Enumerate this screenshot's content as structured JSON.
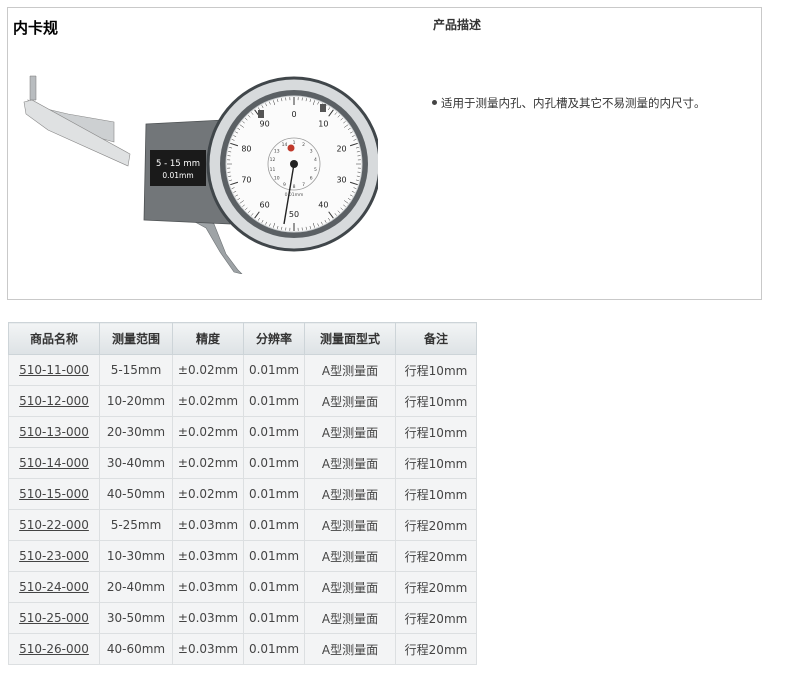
{
  "product": {
    "title": "内卡规",
    "image_label_range": "5 - 15 mm",
    "image_label_resolution": "0.01mm",
    "dial_numbers_outer": [
      "0",
      "10",
      "20",
      "30",
      "40",
      "50",
      "60",
      "70",
      "80",
      "90"
    ],
    "dial_numbers_inner": [
      "1",
      "2",
      "3",
      "4",
      "5",
      "6",
      "7",
      "8",
      "9",
      "10",
      "11",
      "12",
      "13",
      "14"
    ],
    "dial_small_text": "0.01mm"
  },
  "description": {
    "heading": "产品描述",
    "items": [
      "适用于测量内孔、内孔槽及其它不易测量的内尺寸。"
    ]
  },
  "table": {
    "headers": [
      "商品名称",
      "测量范围",
      "精度",
      "分辨率",
      "测量面型式",
      "备注"
    ],
    "rows": [
      [
        "510-11-000",
        "5-15mm",
        "±0.02mm",
        "0.01mm",
        "A型测量面",
        "行程10mm"
      ],
      [
        "510-12-000",
        "10-20mm",
        "±0.02mm",
        "0.01mm",
        "A型测量面",
        "行程10mm"
      ],
      [
        "510-13-000",
        "20-30mm",
        "±0.02mm",
        "0.01mm",
        "A型测量面",
        "行程10mm"
      ],
      [
        "510-14-000",
        "30-40mm",
        "±0.02mm",
        "0.01mm",
        "A型测量面",
        "行程10mm"
      ],
      [
        "510-15-000",
        "40-50mm",
        "±0.02mm",
        "0.01mm",
        "A型测量面",
        "行程10mm"
      ],
      [
        "510-22-000",
        "5-25mm",
        "±0.03mm",
        "0.01mm",
        "A型测量面",
        "行程20mm"
      ],
      [
        "510-23-000",
        "10-30mm",
        "±0.03mm",
        "0.01mm",
        "A型测量面",
        "行程20mm"
      ],
      [
        "510-24-000",
        "20-40mm",
        "±0.03mm",
        "0.01mm",
        "A型测量面",
        "行程20mm"
      ],
      [
        "510-25-000",
        "30-50mm",
        "±0.03mm",
        "0.01mm",
        "A型测量面",
        "行程20mm"
      ],
      [
        "510-26-000",
        "40-60mm",
        "±0.03mm",
        "0.01mm",
        "A型测量面",
        "行程20mm"
      ]
    ]
  }
}
